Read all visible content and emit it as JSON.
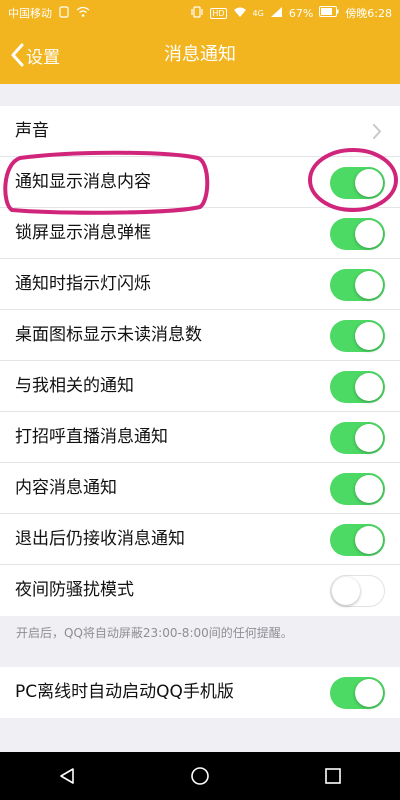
{
  "status_bar": {
    "carrier": "中国移动",
    "network_badge": "HD",
    "signal_label": "4G",
    "battery": "67%",
    "time": "傍晚6:28"
  },
  "nav": {
    "back_label": "设置",
    "title": "消息通知"
  },
  "settings": {
    "sound": {
      "label": "声音"
    },
    "items": [
      {
        "label": "通知显示消息内容",
        "enabled": true
      },
      {
        "label": "锁屏显示消息弹框",
        "enabled": true
      },
      {
        "label": "通知时指示灯闪烁",
        "enabled": true
      },
      {
        "label": "桌面图标显示未读消息数",
        "enabled": true
      },
      {
        "label": "与我相关的通知",
        "enabled": true
      },
      {
        "label": "打招呼直播消息通知",
        "enabled": true
      },
      {
        "label": "内容消息通知",
        "enabled": true
      },
      {
        "label": "退出后仍接收消息通知",
        "enabled": true
      },
      {
        "label": "夜间防骚扰模式",
        "enabled": false
      }
    ],
    "night_mode_hint": "开启后，QQ将自动屏蔽23:00-8:00间的任何提醒。",
    "pc_offline": {
      "label": "PC离线时自动启动QQ手机版",
      "enabled": true
    }
  },
  "colors": {
    "header": "#f2b51f",
    "toggle_on": "#4cd964",
    "annotation": "#d0257a"
  },
  "icons": [
    "chevron-left-icon",
    "chevron-right-icon",
    "triangle-back-icon",
    "circle-home-icon",
    "square-recents-icon"
  ]
}
